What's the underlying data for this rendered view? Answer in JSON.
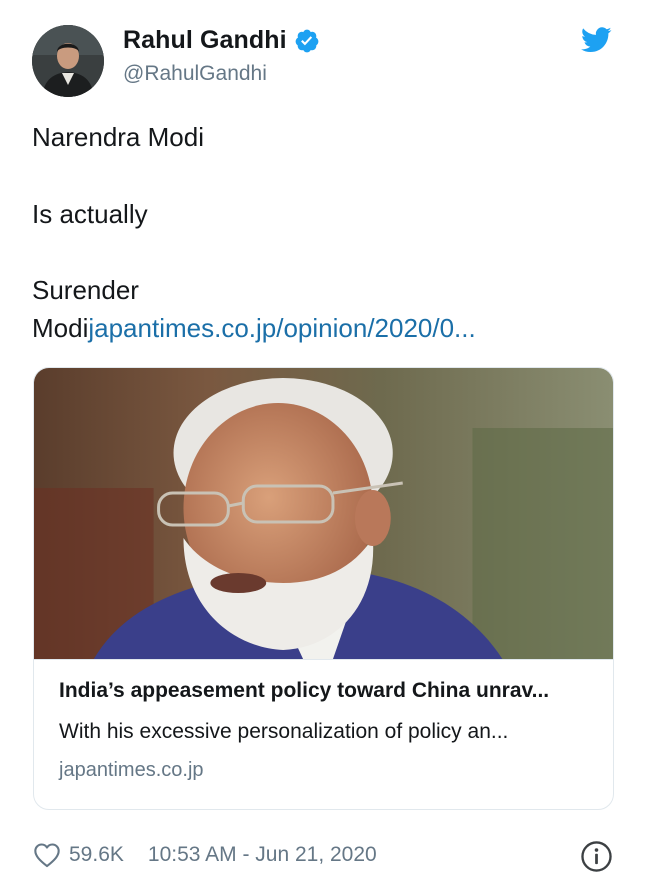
{
  "author": {
    "display_name": "Rahul Gandhi",
    "handle": "@RahulGandhi",
    "verified": true,
    "avatar_icon": "avatar-photo"
  },
  "tweet": {
    "line1": "Narendra Modi",
    "line2": "Is actually",
    "line3": "Surender",
    "line4_text": "Modi",
    "line4_link": "japantimes.co.jp/opinion/2020/0..."
  },
  "card": {
    "title": "India’s appeasement policy toward China unrav...",
    "description": "With his excessive personalization of policy an...",
    "domain": "japantimes.co.jp",
    "image_icon": "article-photo"
  },
  "footer": {
    "likes": "59.6K",
    "timestamp": "10:53 AM - Jun 21, 2020"
  },
  "colors": {
    "twitter_blue": "#1da1f2",
    "link": "#1b6fa8",
    "secondary_text": "#657786",
    "border": "#e1e8ed"
  }
}
